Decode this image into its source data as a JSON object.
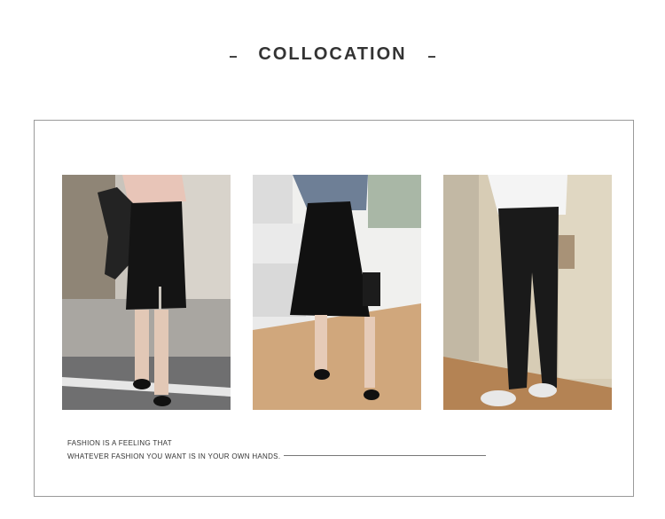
{
  "header": {
    "title": "COLLOCATION"
  },
  "photos": [
    {
      "alt": "black-pencil-skirt-outfit",
      "icon": "photo"
    },
    {
      "alt": "black-a-line-skirt-outfit",
      "icon": "photo"
    },
    {
      "alt": "black-flared-trousers-outfit",
      "icon": "photo"
    }
  ],
  "caption": {
    "line1": "FASHION IS A FEELING THAT",
    "line2": "WHATEVER FASHION YOU WANT IS IN YOUR OWN HANDS."
  }
}
